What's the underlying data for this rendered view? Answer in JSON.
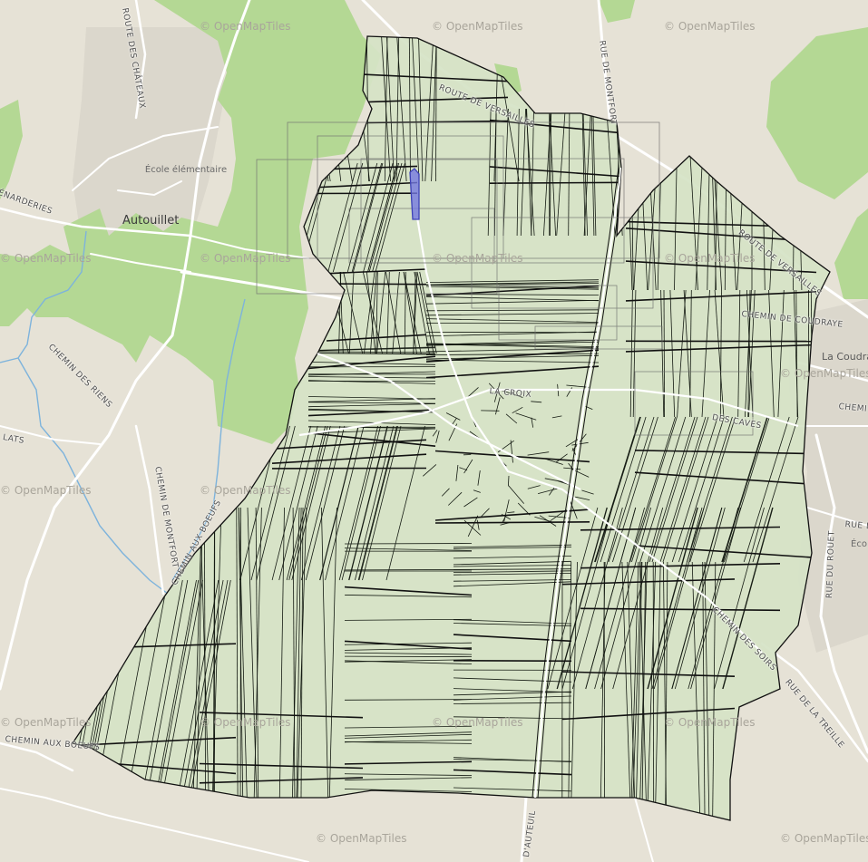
{
  "map": {
    "attribution": "© OpenMapTiles",
    "colors": {
      "background": "#e6e2d6",
      "forest": "#add58a",
      "parcel_fill": "#d5e3c6",
      "parcel_stroke": "#141a12",
      "selected_parcel": "#7478e0",
      "road": "#ffffff",
      "water": "#7db3dc",
      "built_area": "#d8d4ca"
    },
    "places": {
      "autouillet": "Autouillet",
      "ecole_autouillet": "École élémentaire",
      "la_coudraye": "La Coudra",
      "ecole_east": "Éco élém"
    },
    "streets": {
      "route_des_chateaux": "ROUTE DES CHÂTEAUX",
      "menarderies": "ÉNARDERIES",
      "chemin_des_riens": "CHEMIN DES RIENS",
      "lats": "LATS",
      "chemin_de_montfort": "CHEMIN DE MONTFORT",
      "chemin_aux_boeufs_mid": "CHEMIN AUX BOEUFS",
      "chemin_aux_boeufs_sw": "CHEMIN AUX BOEUFS",
      "route_de_versailles": "ROUTE DE VERSAILLES",
      "route_de_versailles_east": "ROUTE DE VERSAILLES",
      "rue_de_montfort": "RUE DE MONTFORT",
      "chemin_de_coudraye": "CHEMIN DE COUDRAYE",
      "chemin_east": "CHEMI",
      "rue_east": "RUE D",
      "rue_du_rouet": "RUE DU ROUET",
      "rue_de_la_treille": "RUE DE LA TREILLE",
      "rue_d_auteuil": "D'AUTEUIL",
      "chemin_des_soirs": "CHEMIN DES SOIRS",
      "des_caves": "DES CAVES",
      "la_croix": "LA CROIX"
    }
  }
}
